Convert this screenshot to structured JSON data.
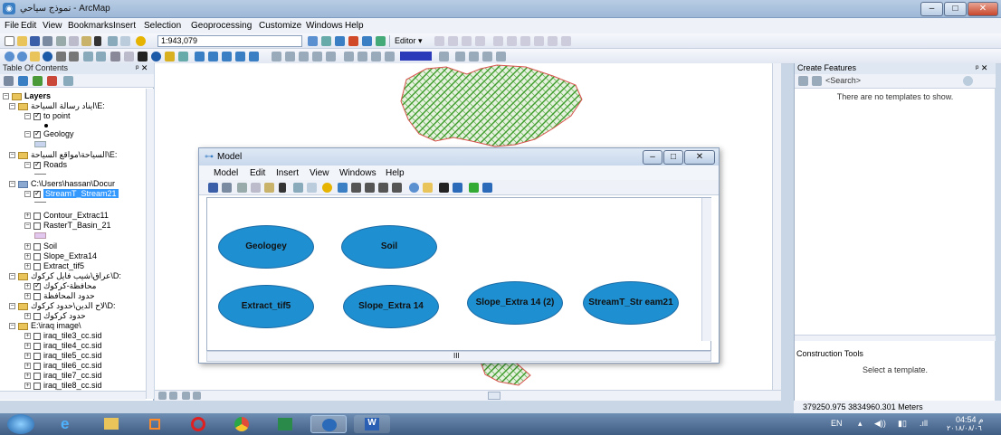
{
  "window": {
    "title": "نموذج سياحي - ArcMap"
  },
  "menubar": [
    "File",
    "Edit",
    "View",
    "Bookmarks",
    "Insert",
    "Selection",
    "Geoprocessing",
    "Customize",
    "Windows",
    "Help"
  ],
  "toolbar": {
    "scale": "1:943,079",
    "editor": "Editor ▾"
  },
  "toc": {
    "title": "Table Of Contents",
    "layers_label": "Layers",
    "rows": [
      "ايناد رسالة السياحة\\E:",
      "to point",
      "Geology",
      "السياحة\\مواقع السياحة\\E:",
      "Roads",
      "C:\\Users\\hassan\\Docur",
      "StreamT_Stream21",
      "Contour_Extrac11",
      "RasterT_Basin_21",
      "Soil",
      "Slope_Extra14",
      "Extract_tif5",
      "عراق\\شيب فايل كركوك\\D:",
      "محافظة-كركوك",
      "حدود المحافظة",
      "لاح الدين\\حدود كركوك\\D:",
      "حدود كركوك",
      "E:\\iraq image\\",
      "iraq_tile3_cc.sid",
      "iraq_tile4_cc.sid",
      "iraq_tile5_cc.sid",
      "iraq_tile6_cc.sid",
      "iraq_tile7_cc.sid",
      "iraq_tile8_cc.sid"
    ]
  },
  "model": {
    "title": "Model",
    "menu": [
      "Model",
      "Edit",
      "Insert",
      "View",
      "Windows",
      "Help"
    ],
    "nodes": [
      "Geologey",
      "Soil",
      "Extract_tif5",
      "Slope_Extra 14",
      "Slope_Extra 14 (2)",
      "StreamT_Str eam21"
    ],
    "scroll_label": "III"
  },
  "right_panel": {
    "title": "Create Features",
    "search_placeholder": "<Search>",
    "empty_msg": "There are no templates to show.",
    "construction_title": "Construction Tools",
    "construction_msg": "Select a template."
  },
  "status": {
    "coordinates": "379250.975  3834960.301 Meters"
  },
  "taskbar": {
    "lang": "EN",
    "time": "04:54 م",
    "date": "٢٠١٨/٠٨/٠٦"
  },
  "colors": {
    "model_node": "#1e8fd0",
    "map_fill": "#3c9a2a",
    "selection": "#3399ff"
  }
}
